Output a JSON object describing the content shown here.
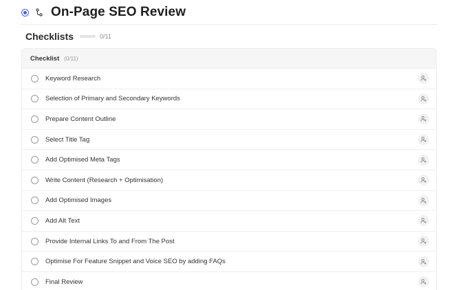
{
  "task": {
    "title": "On-Page SEO Review",
    "status_color": "#4a63d8"
  },
  "checklists": {
    "title": "Checklists",
    "count": "0/11",
    "progress": 0
  },
  "checklist": {
    "title": "Checklist",
    "count": "(0/11)",
    "items": [
      {
        "label": "Keyword Research"
      },
      {
        "label": "Selection of Primary and Secondary Keywords"
      },
      {
        "label": "Prepare Content Outline"
      },
      {
        "label": "Select Title Tag"
      },
      {
        "label": "Add Optimised Meta Tags"
      },
      {
        "label": "Write Content (Research + Optimisation)"
      },
      {
        "label": "Add Optimised Images"
      },
      {
        "label": "Add Alt Text"
      },
      {
        "label": "Provide Internal Links To and From The Post"
      },
      {
        "label": "Optimise For Feature Snippet and Voice SEO by adding FAQs"
      },
      {
        "label": "Final Review"
      }
    ]
  },
  "icons": {
    "status": "status-in-progress-icon",
    "subtask": "subtask-icon",
    "item_check": "circle-checkbox-icon",
    "assign": "assign-user-icon"
  }
}
